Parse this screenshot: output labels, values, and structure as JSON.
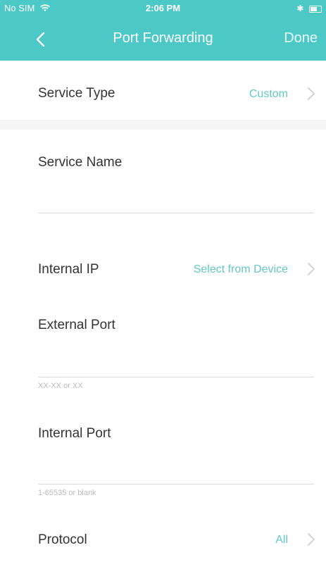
{
  "status_bar": {
    "carrier": "No SIM",
    "time": "2:06 PM"
  },
  "header": {
    "title": "Port Forwarding",
    "done_label": "Done"
  },
  "rows": {
    "service_type": {
      "label": "Service Type",
      "value": "Custom"
    },
    "service_name": {
      "label": "Service Name",
      "value": ""
    },
    "internal_ip": {
      "label": "Internal IP",
      "value": "Select from Device"
    },
    "external_port": {
      "label": "External Port",
      "hint": "XX-XX or XX"
    },
    "internal_port": {
      "label": "Internal Port",
      "hint": "1-65535 or blank"
    },
    "protocol": {
      "label": "Protocol",
      "value": "All"
    }
  },
  "colors": {
    "accent": "#4cc8c6",
    "link": "#62c9c7"
  },
  "icons": {
    "back": "chevron-left-icon",
    "chevron": "chevron-right-icon",
    "wifi": "wifi-icon",
    "bluetooth": "bluetooth-icon",
    "battery": "battery-icon"
  }
}
